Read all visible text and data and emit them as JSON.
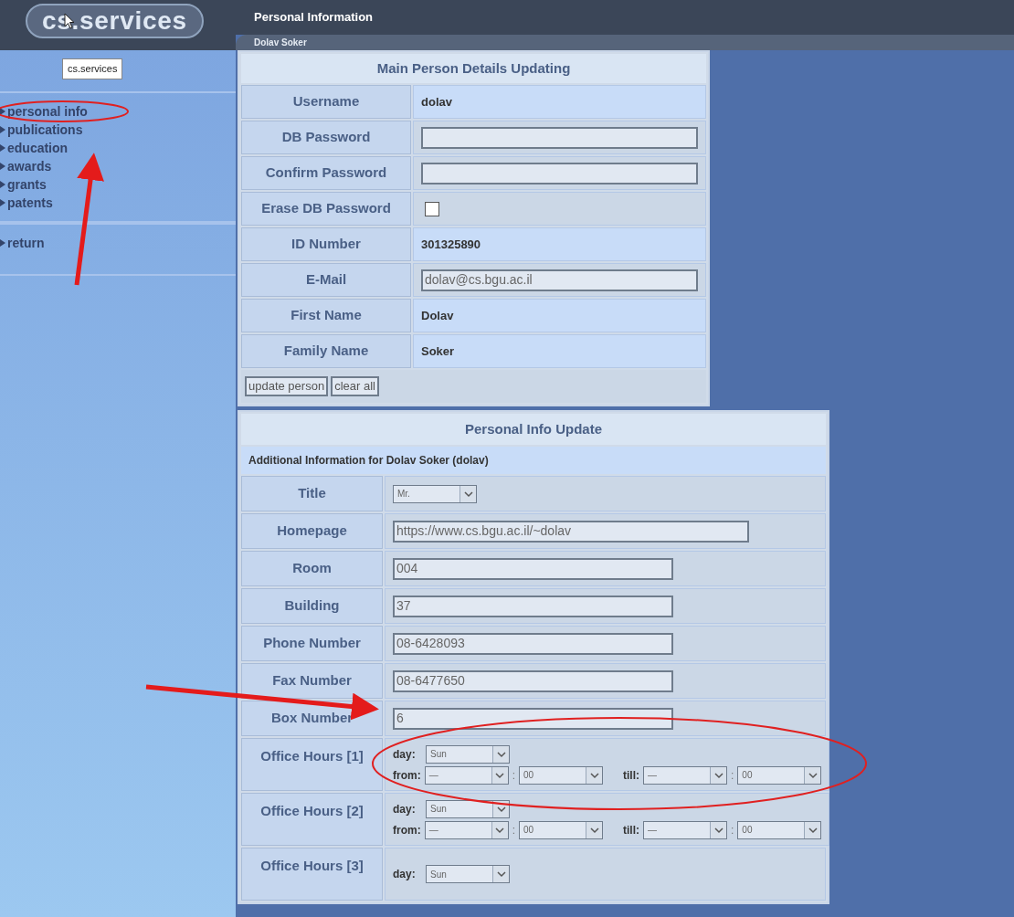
{
  "header": {
    "logo": "cs.services",
    "tooltip": "cs.services",
    "title": "Personal Information",
    "subtitle": "Dolav Soker"
  },
  "sidebar": {
    "groups": [
      [
        {
          "label": "personal info"
        },
        {
          "label": "publications"
        },
        {
          "label": "education"
        },
        {
          "label": "awards"
        },
        {
          "label": "grants"
        },
        {
          "label": "patents"
        }
      ],
      [
        {
          "label": "return"
        }
      ]
    ]
  },
  "main_details": {
    "title": "Main Person Details Updating",
    "rows": [
      {
        "label": "Username",
        "kind": "text",
        "value": "dolav"
      },
      {
        "label": "DB Password",
        "kind": "input"
      },
      {
        "label": "Confirm Password",
        "kind": "input"
      },
      {
        "label": "Erase DB Password",
        "kind": "checkbox",
        "checked": false
      },
      {
        "label": "ID Number",
        "kind": "text",
        "value": "301325890"
      },
      {
        "label": "E-Mail",
        "kind": "input",
        "value": "dolav@cs.bgu.ac.il"
      },
      {
        "label": "First Name",
        "kind": "text",
        "value": "Dolav"
      },
      {
        "label": "Family Name",
        "kind": "text",
        "value": "Soker"
      }
    ],
    "buttons": [
      "update person",
      "clear all"
    ]
  },
  "personal_info": {
    "title": "Personal Info Update",
    "subtitle": "Additional Information for Dolav Soker (dolav)",
    "rows": [
      {
        "label": "Title",
        "kind": "select",
        "value": "Mr."
      },
      {
        "label": "Homepage",
        "kind": "wide_input",
        "value": "https://www.cs.bgu.ac.il/~dolav"
      },
      {
        "label": "Room",
        "kind": "input",
        "value": "004"
      },
      {
        "label": "Building",
        "kind": "input",
        "value": "37"
      },
      {
        "label": "Phone Number",
        "kind": "input",
        "value": "08-6428093"
      },
      {
        "label": "Fax Number",
        "kind": "input",
        "value": "08-6477650"
      },
      {
        "label": "Box Number",
        "kind": "input",
        "value": "6"
      },
      {
        "label": "Office Hours [1]",
        "kind": "office_hours",
        "day_label": "day:",
        "day": "Sun",
        "from_label": "from:",
        "from_hour": "—",
        "separator": ":",
        "from_minute": "00",
        "till_label": "till:",
        "till_hour": "—",
        "till_separator": ":",
        "till_minute": "00"
      },
      {
        "label": "Office Hours [2]",
        "kind": "office_hours",
        "day_label": "day:",
        "day": "Sun",
        "from_label": "from:",
        "from_hour": "—",
        "separator": ":",
        "from_minute": "00",
        "till_label": "till:",
        "till_hour": "—",
        "till_separator": ":",
        "till_minute": "00"
      },
      {
        "label": "Office Hours [3]",
        "kind": "office_hours",
        "day_label": "day:",
        "day": "Sun"
      }
    ]
  }
}
